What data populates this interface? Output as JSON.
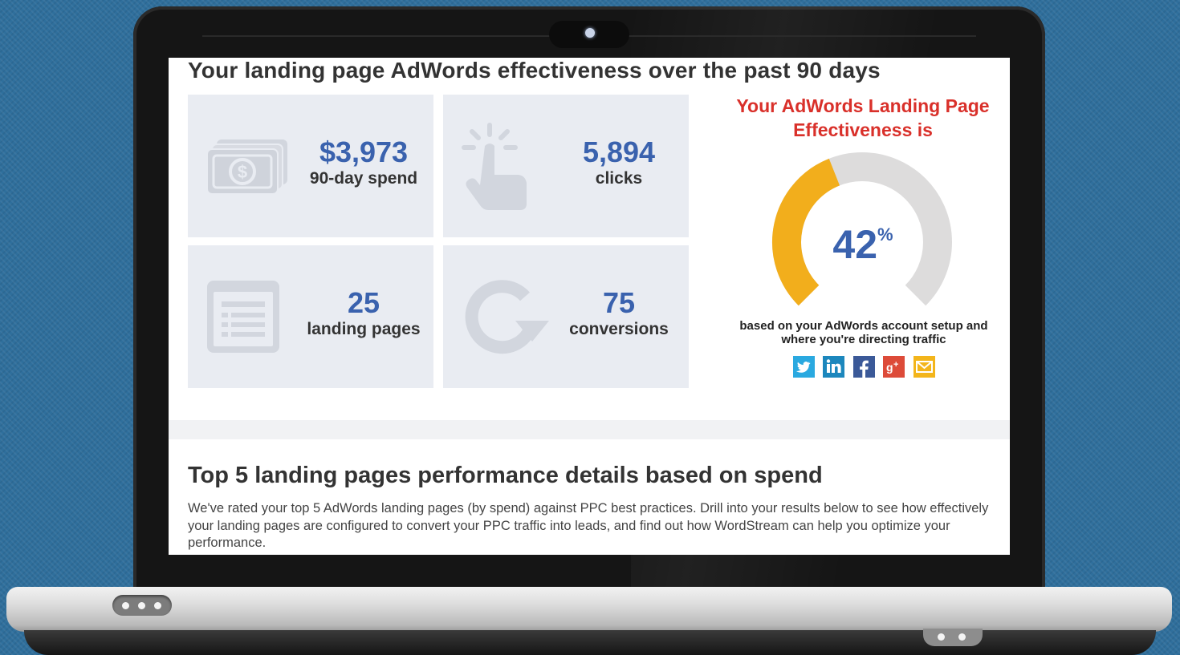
{
  "header": {
    "title": "Your landing page AdWords effectiveness over the past 90 days"
  },
  "stats": [
    {
      "icon": "money-icon",
      "value": "$3,973",
      "label": "90-day spend"
    },
    {
      "icon": "pointer-hand-icon",
      "value": "5,894",
      "label": "clicks"
    },
    {
      "icon": "document-list-icon",
      "value": "25",
      "label": "landing pages"
    },
    {
      "icon": "refresh-icon",
      "value": "75",
      "label": "conversions"
    }
  ],
  "effectiveness": {
    "title": "Your AdWords Landing Page Effectiveness is",
    "value": "42",
    "fraction": 0.42,
    "unit": "%",
    "caption": "based on your AdWords account setup and where you're directing traffic",
    "colors": {
      "filled": "#f2ae1c",
      "empty": "#dddcdc",
      "value": "#3a62ae",
      "title": "#d9302a"
    }
  },
  "share": {
    "buttons": [
      {
        "name": "twitter-icon",
        "color": "#2aa9e0"
      },
      {
        "name": "linkedin-icon",
        "color": "#1c87bd"
      },
      {
        "name": "facebook-icon",
        "color": "#3b5998"
      },
      {
        "name": "google-plus-icon",
        "color": "#dd4b39"
      },
      {
        "name": "email-icon",
        "color": "#f3b51b"
      }
    ]
  },
  "section": {
    "title": "Top 5 landing pages performance details based on spend",
    "body": "We've rated your top 5 AdWords landing pages (by spend) against PPC best practices. Drill into your results below to see how effectively your landing pages are configured to convert your PPC traffic into leads, and find out how WordStream can help you optimize your performance."
  }
}
